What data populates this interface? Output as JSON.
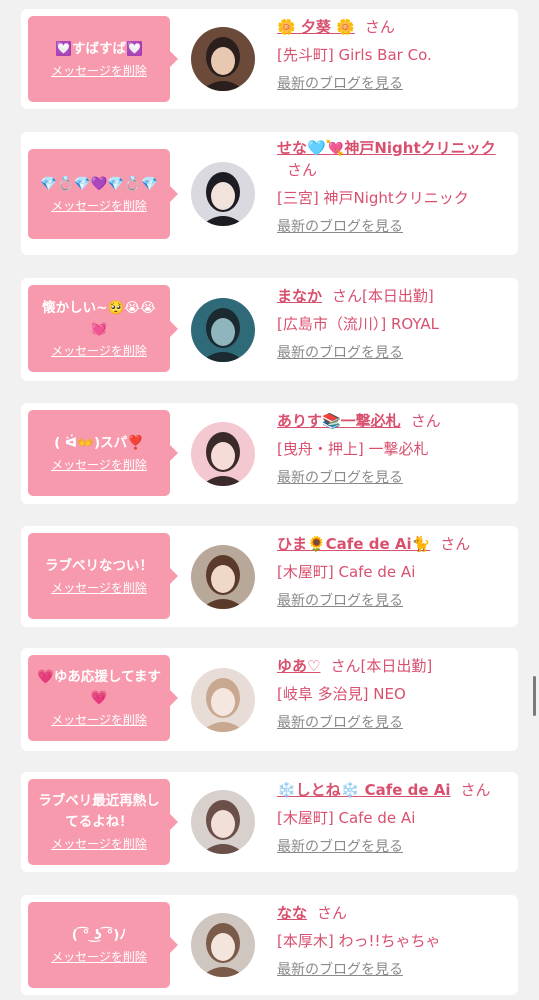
{
  "feed": {
    "cards": [
      {
        "message": "💟すばすば💟",
        "delete_label": "メッセージを削除",
        "name": "🌼 夕葵 🌼",
        "suffix": "さん",
        "status": "",
        "shop": "[先斗町] Girls Bar Co.",
        "blog_link": "最新のブログを見る",
        "avatar_colors": [
          "#6b4a3a",
          "#e8c8b0",
          "#2a1f1c"
        ]
      },
      {
        "message": "💎💍💎💜💎💍💎",
        "delete_label": "メッセージを削除",
        "name": "せな🩵💘神戸Nightクリニック",
        "suffix": "さん",
        "status": "",
        "shop": "[三宮] 神戸Nightクリニック",
        "blog_link": "最新のブログを見る",
        "avatar_colors": [
          "#d9d9df",
          "#f2e2dc",
          "#1c1c22"
        ]
      },
      {
        "message": "懐かしい~🥺😭😭💓",
        "delete_label": "メッセージを削除",
        "name": "まなか",
        "suffix": "さん",
        "status": "[本日出勤]",
        "shop": "[広島市（流川）] ROYAL",
        "blog_link": "最新のブログを見る",
        "avatar_colors": [
          "#2f6a78",
          "#8fb5bd",
          "#1a2a30"
        ]
      },
      {
        "message": "( ᐛ👐)スパ❣️",
        "delete_label": "メッセージを削除",
        "name": "ありす📚一撃必札",
        "suffix": "さん",
        "status": "",
        "shop": "[曳舟・押上] 一撃必札",
        "blog_link": "最新のブログを見る",
        "avatar_colors": [
          "#f4c8d0",
          "#f6dcd8",
          "#3a2a2a"
        ]
      },
      {
        "message": "ラブベリなつい！",
        "delete_label": "メッセージを削除",
        "name": "ひま🌻Cafe de Ai🐈",
        "suffix": "さん",
        "status": "",
        "shop": "[木屋町] Cafe de Ai",
        "blog_link": "最新のブログを見る",
        "avatar_colors": [
          "#b8a89a",
          "#f0d8c8",
          "#5a3a2a"
        ]
      },
      {
        "message": "💗ゆあ応援してます💗",
        "delete_label": "メッセージを削除",
        "name": "ゆあ♡",
        "suffix": "さん",
        "status": "[本日出勤]",
        "shop": "[岐阜 多治見] NEO",
        "blog_link": "最新のブログを見る",
        "avatar_colors": [
          "#e8dcd6",
          "#f6e6e0",
          "#c8a890"
        ]
      },
      {
        "message": "ラブベリ最近再熱してるよね！",
        "delete_label": "メッセージを削除",
        "name": "❄️しとね❄️ Cafe de Ai",
        "suffix": "さん",
        "status": "",
        "shop": "[木屋町] Cafe de Ai",
        "blog_link": "最新のブログを見る",
        "avatar_colors": [
          "#d8d0cc",
          "#f2e0d8",
          "#6a5048"
        ]
      },
      {
        "message": "( ͡° ͜ʖ ͡°)ﾉ",
        "delete_label": "メッセージを削除",
        "name": "なな",
        "suffix": "さん",
        "status": "",
        "shop": "[本厚木] わっ!!ちゃちゃ",
        "blog_link": "最新のブログを見る",
        "avatar_colors": [
          "#cfc6c0",
          "#f3e4dc",
          "#7a5a48"
        ]
      }
    ]
  }
}
